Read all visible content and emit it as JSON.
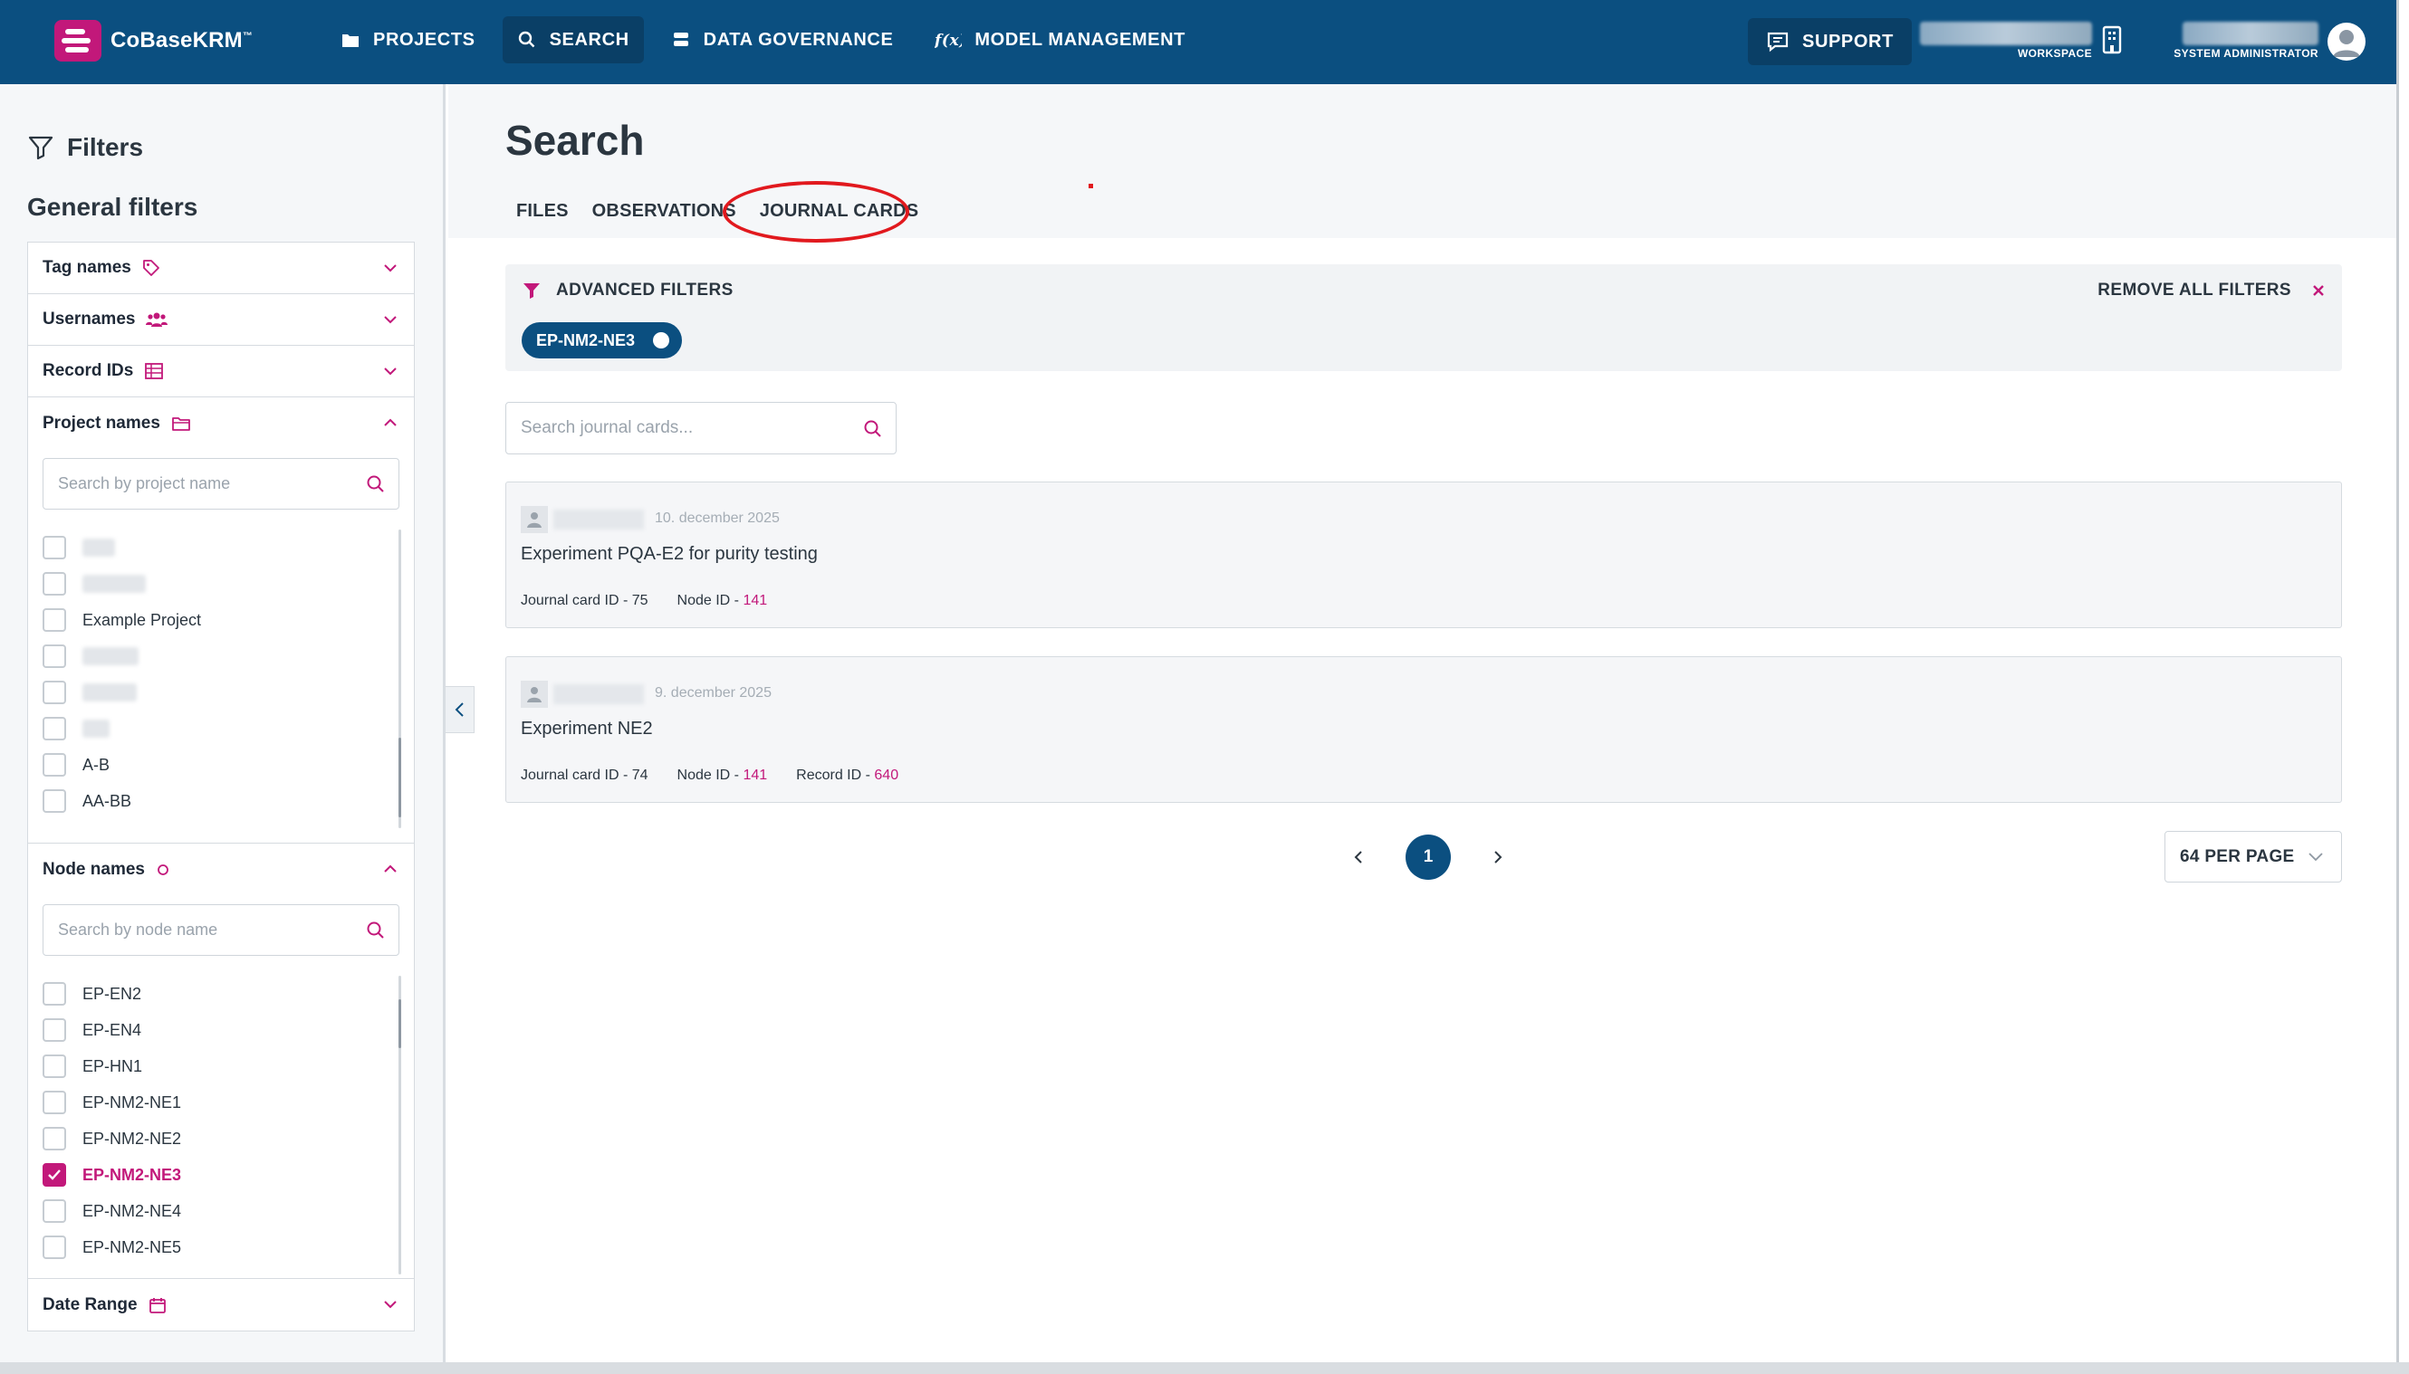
{
  "app": {
    "brand": "CoBaseKRM",
    "trademark": "™"
  },
  "nav": {
    "items": [
      {
        "label": "PROJECTS",
        "icon": "folder-icon"
      },
      {
        "label": "SEARCH",
        "icon": "search-icon",
        "active": true
      },
      {
        "label": "DATA GOVERNANCE",
        "icon": "database-icon"
      },
      {
        "label": "MODEL MANAGEMENT",
        "icon": "function-icon"
      }
    ],
    "support_label": "SUPPORT",
    "workspace_label": "WORKSPACE",
    "user_role": "SYSTEM ADMINISTRATOR"
  },
  "sidebar": {
    "title": "Filters",
    "section_title": "General filters",
    "filters": [
      {
        "label": "Tag names",
        "icon": "tag-icon",
        "expanded": false
      },
      {
        "label": "Usernames",
        "icon": "users-icon",
        "expanded": false
      },
      {
        "label": "Record IDs",
        "icon": "table-icon",
        "expanded": false
      },
      {
        "label": "Project names",
        "icon": "folder-open-icon",
        "expanded": true
      },
      {
        "label": "Node names",
        "icon": "circle-icon",
        "expanded": true
      },
      {
        "label": "Date Range",
        "icon": "calendar-icon",
        "expanded": false
      }
    ],
    "project_search_placeholder": "Search by project name",
    "project_items": [
      {
        "label": "",
        "hidden": true
      },
      {
        "label": "",
        "hidden": true
      },
      {
        "label": "Example Project"
      },
      {
        "label": "",
        "hidden": true
      },
      {
        "label": "",
        "hidden": true
      },
      {
        "label": "",
        "hidden": true
      },
      {
        "label": "A-B"
      },
      {
        "label": "AA-BB"
      }
    ],
    "node_search_placeholder": "Search by node name",
    "node_items": [
      {
        "label": "EP-EN2",
        "checked": false
      },
      {
        "label": "EP-EN4",
        "checked": false
      },
      {
        "label": "EP-HN1",
        "checked": false
      },
      {
        "label": "EP-NM2-NE1",
        "checked": false
      },
      {
        "label": "EP-NM2-NE2",
        "checked": false
      },
      {
        "label": "EP-NM2-NE3",
        "checked": true
      },
      {
        "label": "EP-NM2-NE4",
        "checked": false
      },
      {
        "label": "EP-NM2-NE5",
        "checked": false
      }
    ]
  },
  "main": {
    "title": "Search",
    "tabs": [
      {
        "label": "FILES"
      },
      {
        "label": "OBSERVATIONS"
      },
      {
        "label": "JOURNAL CARDS",
        "active": true
      }
    ],
    "advanced_filters_label": "ADVANCED FILTERS",
    "remove_all_label": "REMOVE ALL FILTERS",
    "active_chip": "EP-NM2-NE3",
    "journal_search_placeholder": "Search journal cards...",
    "cards": [
      {
        "date": "10. december 2025",
        "title": "Experiment PQA-E2 for purity testing",
        "journal_card_label": "Journal card ID - ",
        "journal_card_id": "75",
        "node_label": "Node ID - ",
        "node_id": "141"
      },
      {
        "date": "9. december 2025",
        "title": "Experiment NE2",
        "journal_card_label": "Journal card ID - ",
        "journal_card_id": "74",
        "node_label": "Node ID - ",
        "node_id": "141",
        "record_label": "Record ID - ",
        "record_id": "640"
      }
    ],
    "pagination": {
      "current_page": "1",
      "per_page": "64 PER PAGE"
    }
  },
  "colors": {
    "topbar": "#0b4f80",
    "accent": "#c2187a",
    "highlight": "#e1191e"
  }
}
